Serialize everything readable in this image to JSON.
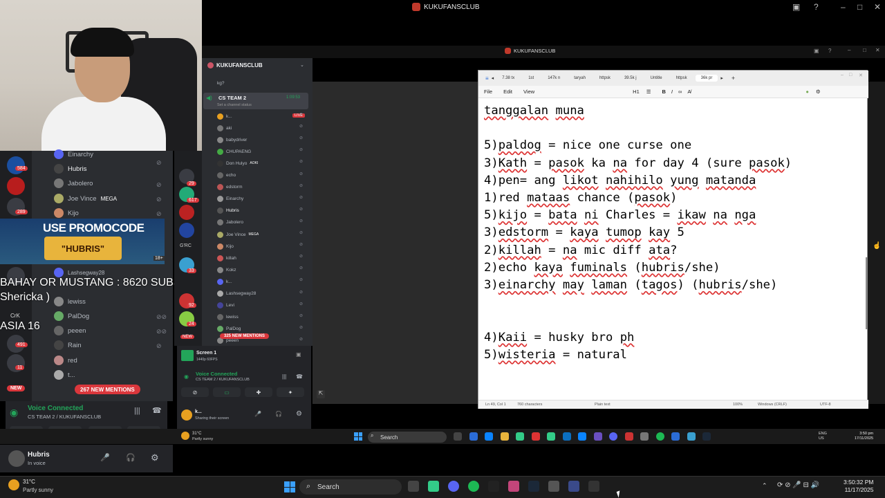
{
  "window": {
    "title": "KUKUFANSCLUB",
    "inner_title": "KUKUFANSCLUB"
  },
  "discord_left": {
    "members": [
      "Einarchy",
      "Hubris",
      "Jabolero",
      "Joe Vince",
      "Kijo",
      "Lashsegway28",
      "lewiss",
      "PalDog",
      "peeen",
      "Rain",
      "red",
      "t..."
    ],
    "mega_badge": "MEGA",
    "server_badges": [
      "584",
      "289",
      "113",
      "491",
      "11"
    ],
    "new_pill": "NEW",
    "mentions": "267 NEW MENTIONS",
    "voice_connected": "Voice Connected",
    "voice_channel": "CS TEAM 2 / KUKUFANSCLUB",
    "user_name": "Hubris",
    "user_status": "In voice"
  },
  "promo": {
    "line1": "USE PROMOCODE",
    "line2": "\"HUBRIS\"",
    "rating": "18+"
  },
  "overlay": {
    "line1": "BAHAY OR MUSTANG : 8620 SUBS",
    "line2": "Shericka )",
    "line3": "CrK",
    "line4": "ASIA 16"
  },
  "discord_mid": {
    "server_name": "KUKUFANSCLUB",
    "top_item": "kg?",
    "channel": "CS TEAM 2",
    "channel_status": "Set a channel status",
    "channel_time": "1:09:53",
    "live": "LIVE",
    "members": [
      "k...",
      "aki",
      "babydriver",
      "CHUPAENG",
      "Don Hulyo",
      "echo",
      "edstorm",
      "Einarchy",
      "Hubris",
      "Jabolero",
      "Joe Vince",
      "Kijo",
      "killah",
      "Kokz",
      "k...",
      "Lashsegway28",
      "Levi",
      "lewiss",
      "PalDog",
      "peeen"
    ],
    "aoki_badge": "AOKI",
    "mega_badge": "MEGA",
    "server_badges": [
      "29",
      "617",
      "33",
      "92",
      "24"
    ],
    "new_pill": "NEW",
    "mentions": "325 NEW MENTIONS",
    "screen_title": "Screen 1",
    "screen_sub": "1440p 60FPS",
    "voice_connected": "Voice Connected",
    "voice_channel": "CS TEAM 2 / KUKUFANSCLUB",
    "user_name": "k...",
    "user_status": "Sharing their screen"
  },
  "notepad": {
    "tabs": [
      "7.38 tx",
      "1st",
      "147k n",
      "taryah",
      "httpsk",
      "39.5k j",
      "Untitle",
      "httpsk",
      "36k pr"
    ],
    "menu": [
      "File",
      "Edit",
      "View"
    ],
    "heading": "H1",
    "lines": [
      "tanggalan muna",
      "",
      "5)paldog = nice one curse one",
      "3)Kath = pasok ka na for day 4 (sure pasok)",
      "4)pen= ang likot nahihilo yung matanda",
      "1)red mataas chance (pasok)",
      "5)kijo = bata ni Charles = ikaw na nga",
      "3)edstorm = kaya tumop kay 5",
      "2)killah = na mic diff ata?",
      "2)echo kaya fuminals (hubris/she)",
      "3)einarchy may laman (tagos) (hubris/she)",
      "",
      "",
      "4)Kaii = husky bro ph",
      "5)wisteria = natural"
    ],
    "status": {
      "pos": "Ln 49, Col 1",
      "chars": "760 characters",
      "type": "Plain text",
      "zoom": "100%",
      "eol": "Windows (CRLF)",
      "enc": "UTF-8"
    }
  },
  "taskbar": {
    "search": "Search",
    "weather_temp": "31°C",
    "weather_desc": "Partly sunny",
    "time": "3:50:32 PM",
    "date": "11/17/2025"
  },
  "taskbar2": {
    "search": "Search",
    "weather_temp": "31°C",
    "weather_desc": "Partly sunny",
    "lang1": "ENG",
    "lang2": "US",
    "time": "3:50 pm",
    "date": "17/11/2025"
  },
  "colors": {
    "discord_bg": "#2b2d31",
    "discord_dark": "#1e1f22",
    "accent_red": "#da373c",
    "voice_green": "#23a55a"
  }
}
